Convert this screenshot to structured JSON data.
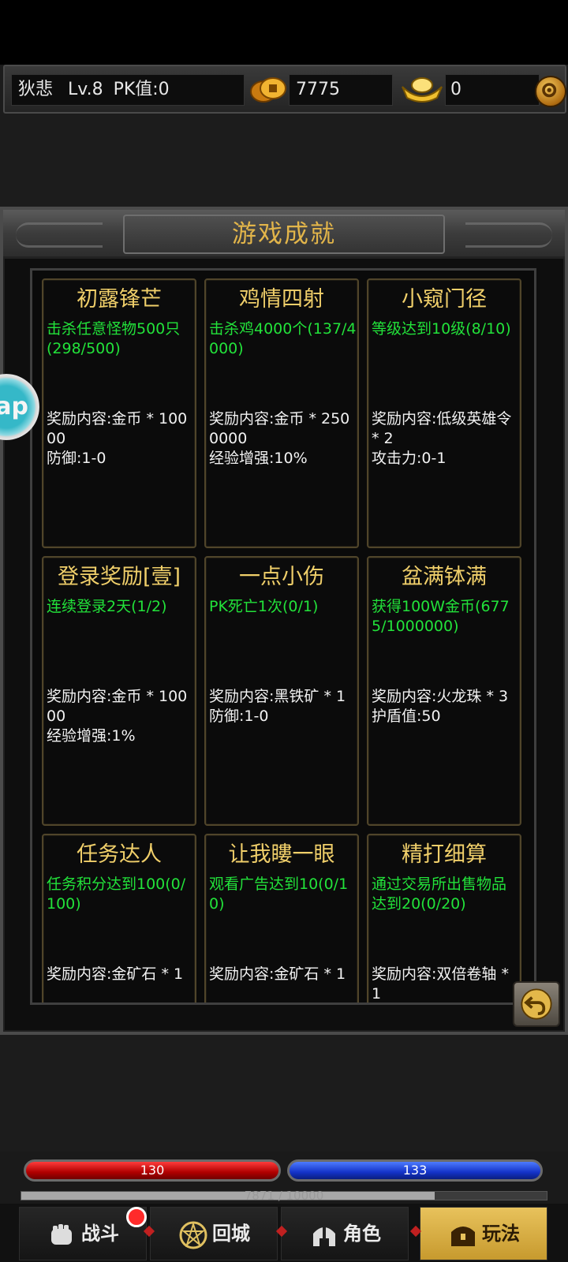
{
  "player": {
    "name": "狄悲",
    "level": "Lv.8",
    "pk": "PK值:0",
    "gold": "7775",
    "ingot": "0"
  },
  "panel": {
    "title": "游戏成就"
  },
  "achievements": [
    {
      "title": "初露锋芒",
      "task": "击杀任意怪物500只(298/500)",
      "reward": "奖励内容:金币 * 10000\n防御:1-0"
    },
    {
      "title": "鸡情四射",
      "task": "击杀鸡4000个(137/4000)",
      "reward": "奖励内容:金币 * 2500000\n经验增强:10%"
    },
    {
      "title": "小窥门径",
      "task": "等级达到10级(8/10)",
      "reward": "奖励内容:低级英雄令 * 2\n攻击力:0-1"
    },
    {
      "title": "登录奖励[壹]",
      "task": "连续登录2天(1/2)",
      "reward": "奖励内容:金币 * 10000\n经验增强:1%"
    },
    {
      "title": "一点小伤",
      "task": "PK死亡1次(0/1)",
      "reward": "奖励内容:黑铁矿 * 1\n防御:1-0"
    },
    {
      "title": "盆满钵满",
      "task": "获得100W金币(6775/1000000)",
      "reward": "奖励内容:火龙珠 * 3\n护盾值:50"
    },
    {
      "title": "任务达人",
      "task": "任务积分达到100(0/100)",
      "reward": "奖励内容:金矿石 * 1"
    },
    {
      "title": "让我瞜一眼",
      "task": "观看广告达到10(0/10)",
      "reward": "奖励内容:金矿石 * 1"
    },
    {
      "title": "精打细算",
      "task": "通过交易所出售物品达到20(0/20)",
      "reward": "奖励内容:双倍卷轴 * 1"
    }
  ],
  "floating_button": "ap",
  "status": {
    "hp": "130",
    "mp": "133",
    "exp": "7871 / 10000",
    "exp_fraction": 0.7871
  },
  "nav": {
    "battle": "战斗",
    "return_city": "回城",
    "character": "角色",
    "gameplay": "玩法"
  },
  "colors": {
    "title_gold": "#f0cf6a",
    "task_green": "#22e23a",
    "hp_red": "#d40000",
    "mp_blue": "#1f44e0",
    "active_tab": "#d8ae40"
  }
}
